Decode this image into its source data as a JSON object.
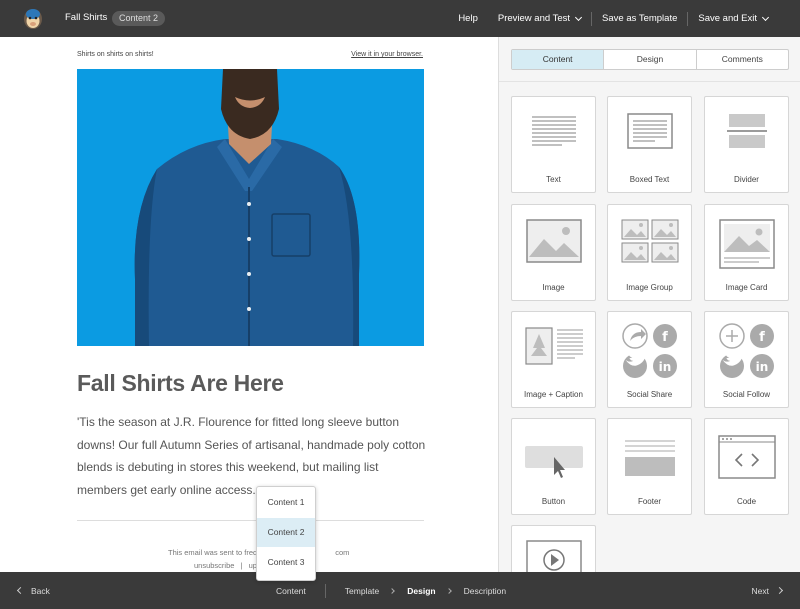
{
  "header": {
    "campaign_name": "Fall Shirts",
    "campaign_pill": "Content 2",
    "actions": {
      "help": "Help",
      "preview_test": "Preview and Test",
      "save_template": "Save as Template",
      "save_exit": "Save and Exit"
    }
  },
  "email": {
    "preheader": "Shirts on shirts on shirts!",
    "browser_link": "View it in your browser.",
    "headline": "Fall Shirts Are Here",
    "body": "'Tis the season at J.R. Flourence for fitted long sleeve button downs! Our full Autumn Series of artisanal, handmade poly cotton blends is debuting in stores this weekend, but mailing list members get early online access.",
    "footer_text": "This email was sent to fred",
    "footer_text_tail": "com",
    "footer_links_unsubscribe": "unsubscribe",
    "footer_links_sep": "|",
    "footer_links_tail": "upd",
    "hero_bg": "#0b9be2"
  },
  "dropdown": {
    "options": [
      "Content 1",
      "Content 2",
      "Content 3"
    ],
    "selected": "Content 2"
  },
  "panel": {
    "tabs": [
      "Content",
      "Design",
      "Comments"
    ],
    "active_tab": "Content",
    "blocks": [
      {
        "label": "Text",
        "icon": "text-block-icon"
      },
      {
        "label": "Boxed Text",
        "icon": "boxed-text-icon"
      },
      {
        "label": "Divider",
        "icon": "divider-icon"
      },
      {
        "label": "Image",
        "icon": "image-icon"
      },
      {
        "label": "Image Group",
        "icon": "image-group-icon"
      },
      {
        "label": "Image Card",
        "icon": "image-card-icon"
      },
      {
        "label": "Image + Caption",
        "icon": "image-caption-icon"
      },
      {
        "label": "Social Share",
        "icon": "social-share-icon"
      },
      {
        "label": "Social Follow",
        "icon": "social-follow-icon"
      },
      {
        "label": "Button",
        "icon": "button-block-icon"
      },
      {
        "label": "Footer",
        "icon": "footer-icon"
      },
      {
        "label": "Code",
        "icon": "code-icon"
      },
      {
        "label": "",
        "icon": "video-icon"
      }
    ]
  },
  "footer_nav": {
    "back": "Back",
    "next": "Next",
    "steps": [
      "Content",
      "Template",
      "Design",
      "Description"
    ],
    "current_step": "Design"
  },
  "colors": {
    "topbar": "#3a3a3a",
    "accent_tab": "#d6ecf4",
    "hero": "#0b9be2"
  }
}
